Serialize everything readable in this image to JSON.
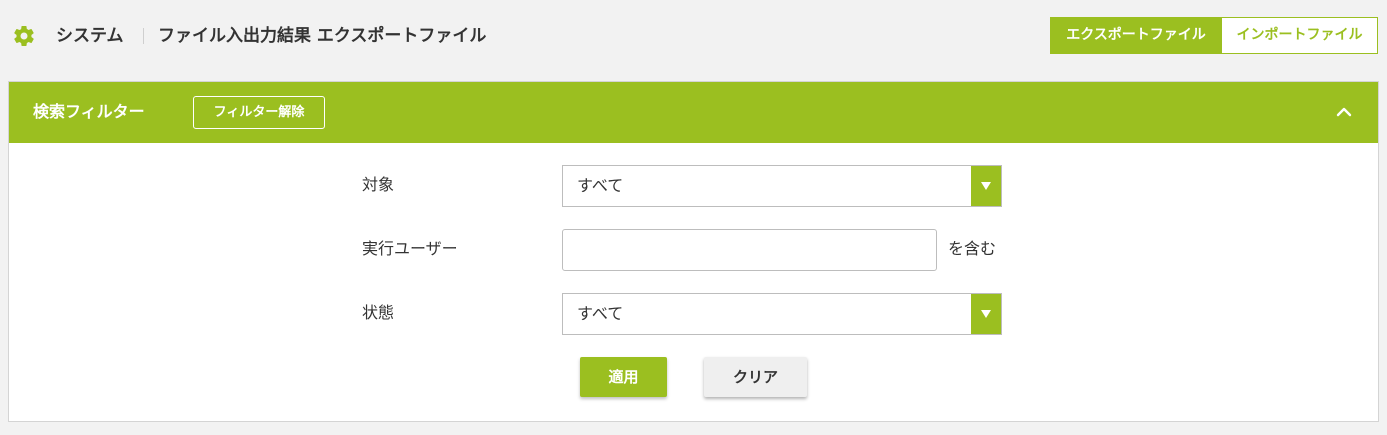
{
  "header": {
    "breadcrumb_system": "システム",
    "breadcrumb_page": "ファイル入出力結果 エクスポートファイル",
    "icon": "gear-icon",
    "tabs": [
      {
        "label": "エクスポートファイル",
        "active": true
      },
      {
        "label": "インポートファイル",
        "active": false
      }
    ]
  },
  "filter": {
    "title": "検索フィルター",
    "clear_filter_label": "フィルター解除",
    "collapse_icon": "chevron-up-icon",
    "fields": {
      "target": {
        "label": "対象",
        "value": "すべて"
      },
      "user": {
        "label": "実行ユーザー",
        "value": "",
        "suffix": "を含む"
      },
      "status": {
        "label": "状態",
        "value": "すべて"
      }
    },
    "apply_label": "適用",
    "clear_label": "クリア"
  },
  "colors": {
    "accent": "#9bbf20",
    "background": "#f2f2f2"
  }
}
